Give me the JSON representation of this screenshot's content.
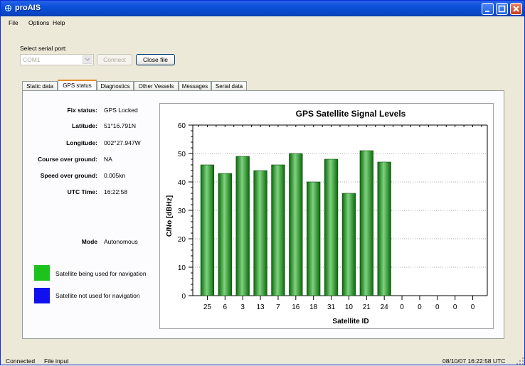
{
  "window": {
    "title": "proAIS"
  },
  "menu": [
    "File",
    "Options",
    "Help"
  ],
  "serial": {
    "label": "Select serial port:",
    "port": "COM1",
    "connect": "Connect",
    "close_file": "Close file"
  },
  "tabs": [
    "Static data",
    "GPS status",
    "Diagnostics",
    "Other Vessels",
    "Messages",
    "Serial data"
  ],
  "selected_tab": "GPS status",
  "gps": {
    "fix_label": "Fix status:",
    "fix_value": "GPS Locked",
    "lat_label": "Latitude:",
    "lat_value": "51°16.791N",
    "lon_label": "Longitude:",
    "lon_value": "002°27.947W",
    "cog_label": "Course over ground:",
    "cog_value": "NA",
    "sog_label": "Speed over ground:",
    "sog_value": "0.005kn",
    "utc_label": "UTC Time:",
    "utc_value": "16:22:58",
    "mode_label": "Mode",
    "mode_value": "Autonomous"
  },
  "legend": {
    "used": "Satellite being used for navigation",
    "used_color": "#1dc31d",
    "not_used": "Satellite not used for navigation",
    "not_used_color": "#1010ee"
  },
  "status": {
    "left1": "Connected",
    "left2": "File input",
    "right": "08/10/07 16:22:58 UTC"
  },
  "chart_data": {
    "type": "bar",
    "title": "GPS Satellite Signal Levels",
    "xlabel": "Satellite ID",
    "ylabel": "C/No [dBHz]",
    "ylim": [
      0,
      60
    ],
    "yticks": [
      0,
      10,
      20,
      30,
      40,
      50,
      60
    ],
    "categories": [
      "25",
      "6",
      "3",
      "13",
      "7",
      "16",
      "18",
      "31",
      "10",
      "21",
      "24",
      "0",
      "0",
      "0",
      "0",
      "0"
    ],
    "values": [
      46,
      43,
      49,
      44,
      46,
      50,
      40,
      48,
      36,
      51,
      47,
      0,
      0,
      0,
      0,
      0
    ],
    "bar_color": "#1a8a1a",
    "grid": "horizontal dotted"
  }
}
